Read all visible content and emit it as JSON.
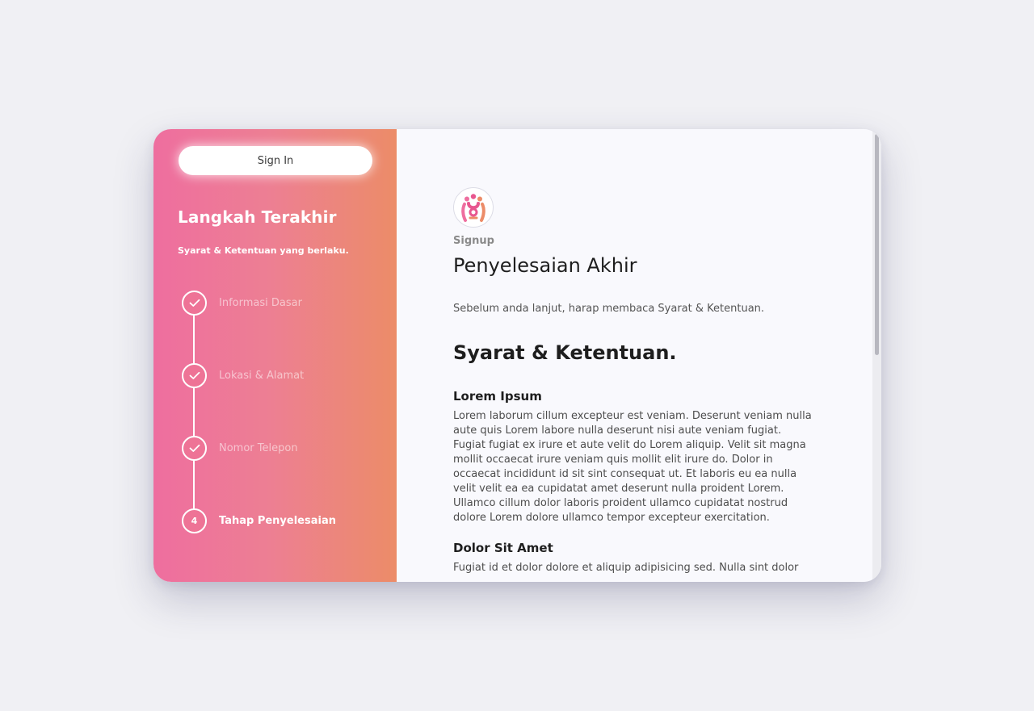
{
  "sidebar": {
    "signin_label": "Sign In",
    "title": "Langkah Terakhir",
    "subtitle": "Syarat & Ketentuan yang berlaku.",
    "steps": [
      {
        "label": "Informasi Dasar",
        "status": "done",
        "icon": "check-icon"
      },
      {
        "label": "Lokasi & Alamat",
        "status": "done",
        "icon": "check-icon"
      },
      {
        "label": "Nomor Telepon",
        "status": "done",
        "icon": "check-icon"
      },
      {
        "label": "Tahap Penyelesaian",
        "status": "active",
        "number": "4"
      }
    ],
    "gradient_colors": [
      "#ee6e9f",
      "#ec8c68"
    ]
  },
  "main": {
    "logo_icon": "community-people-icon",
    "eyebrow": "Signup",
    "title": "Penyelesaian Akhir",
    "intro": "Sebelum anda lanjut, harap membaca Syarat & Ketentuan.",
    "terms_heading": "Syarat & Ketentuan.",
    "sections": [
      {
        "title": "Lorem Ipsum",
        "body": "Lorem laborum cillum excepteur est veniam. Deserunt veniam nulla aute quis Lorem labore nulla deserunt nisi aute veniam fugiat. Fugiat fugiat ex irure et aute velit do Lorem aliquip. Velit sit magna mollit occaecat irure veniam quis mollit elit irure do. Dolor in occaecat incididunt id sit sint consequat ut. Et laboris eu ea nulla velit velit ea ea cupidatat amet deserunt nulla proident Lorem. Ullamco cillum dolor laboris proident ullamco cupidatat nostrud dolore Lorem dolore ullamco tempor excepteur exercitation."
      },
      {
        "title": "Dolor Sit Amet",
        "body": "Fugiat id et dolor dolore et aliquip adipisicing sed. Nulla sint dolor"
      }
    ]
  }
}
